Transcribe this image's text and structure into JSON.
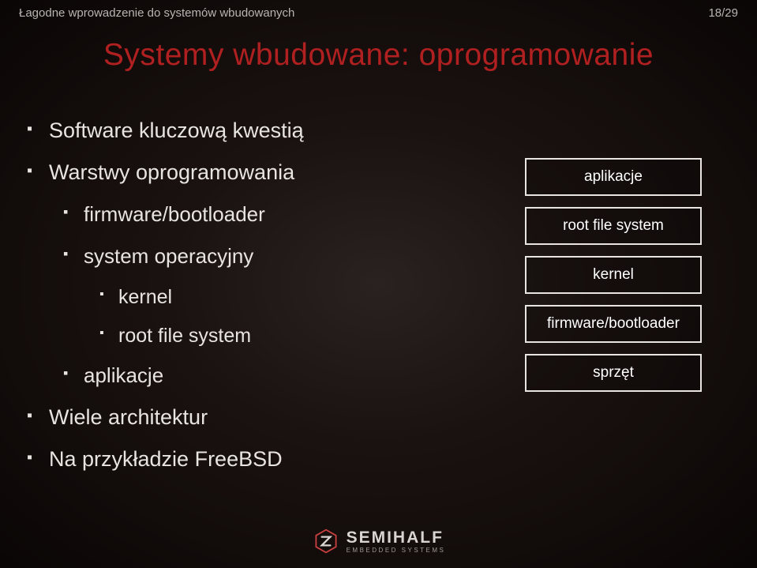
{
  "header": {
    "title": "Łagodne wprowadzenie do systemów wbudowanych",
    "page": "18/29"
  },
  "slide_title": "Systemy wbudowane: oprogramowanie",
  "bullets": {
    "b1_1": "Software kluczową kwestią",
    "b1_2": "Warstwy oprogramowania",
    "b2_1": "firmware/bootloader",
    "b2_2": "system operacyjny",
    "b3_1": "kernel",
    "b3_2": "root file system",
    "b2_3": "aplikacje",
    "b1_3": "Wiele architektur",
    "b1_4": "Na przykładzie FreeBSD"
  },
  "stack": {
    "l1": "aplikacje",
    "l2": "root file system",
    "l3": "kernel",
    "l4": "firmware/bootloader",
    "l5": "sprzęt"
  },
  "footer": {
    "brand": "SEMIHALF",
    "tagline": "EMBEDDED SYSTEMS"
  }
}
